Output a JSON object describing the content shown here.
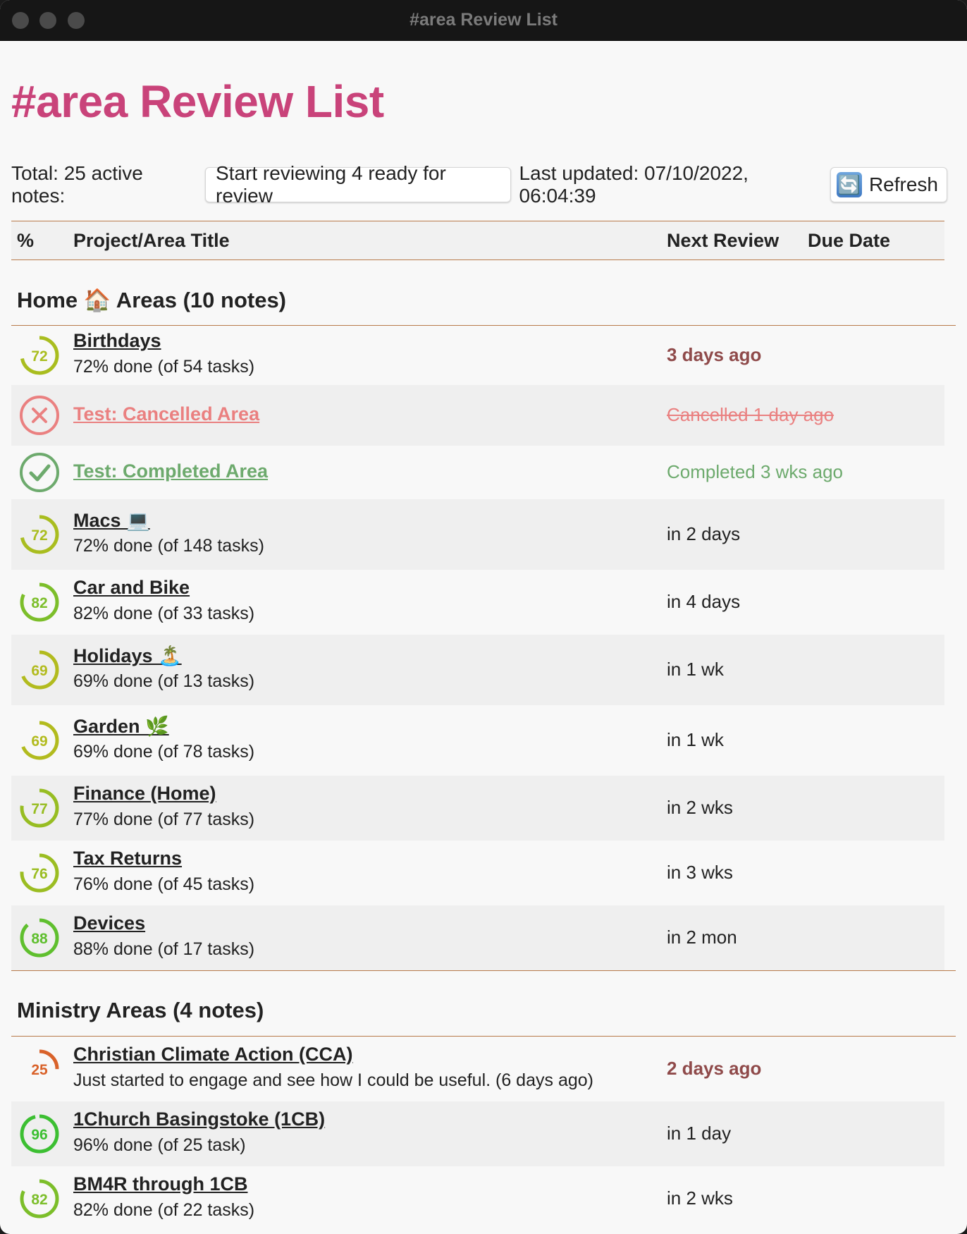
{
  "window": {
    "title": "#area Review List"
  },
  "page": {
    "heading": "#area Review List"
  },
  "toolbar": {
    "total_label": "Total: 25 active notes:",
    "start_button": "Start reviewing 4 ready for review",
    "last_updated": "Last updated: 07/10/2022, 06:04:39",
    "refresh_button": "Refresh",
    "refresh_icon": "🔄"
  },
  "table": {
    "headers": {
      "pct": "%",
      "title": "Project/Area Title",
      "next_review": "Next Review",
      "due_date": "Due Date"
    }
  },
  "sections": [
    {
      "title": "Home 🏠 Areas (10 notes)",
      "rows": [
        {
          "title": "Birthdays",
          "sub": "72% done (of 54 tasks)",
          "review": "3 days ago",
          "status": "overdue",
          "pct": 72,
          "color": "#a9bd1f"
        },
        {
          "title": "Test: Cancelled Area",
          "sub": "",
          "review": "Cancelled 1 day ago",
          "status": "cancelled",
          "pct": null,
          "color": "#ea8080"
        },
        {
          "title": "Test: Completed Area",
          "sub": "",
          "review": "Completed 3 wks ago",
          "status": "completed",
          "pct": null,
          "color": "#6daa6d"
        },
        {
          "title": "Macs 💻",
          "sub": "72% done (of 148 tasks)",
          "review": "in 2 days",
          "status": "normal",
          "pct": 72,
          "color": "#a9bd1f"
        },
        {
          "title": "Car and Bike",
          "sub": "82% done (of 33 tasks)",
          "review": "in 4 days",
          "status": "normal",
          "pct": 82,
          "color": "#7cbe2a"
        },
        {
          "title": "Holidays 🏝️",
          "sub": "69% done (of 13 tasks)",
          "review": "in 1 wk",
          "status": "normal",
          "pct": 69,
          "color": "#b2bb1e"
        },
        {
          "title": "Garden 🌿",
          "sub": "69% done (of 78 tasks)",
          "review": "in 1 wk",
          "status": "normal",
          "pct": 69,
          "color": "#b2bb1e"
        },
        {
          "title": "Finance (Home)",
          "sub": "77% done (of 77 tasks)",
          "review": "in 2 wks",
          "status": "normal",
          "pct": 77,
          "color": "#97bd22"
        },
        {
          "title": "Tax Returns",
          "sub": "76% done (of 45 tasks)",
          "review": "in 3 wks",
          "status": "normal",
          "pct": 76,
          "color": "#9bbd22"
        },
        {
          "title": "Devices",
          "sub": "88% done (of 17 tasks)",
          "review": "in 2 mon",
          "status": "normal",
          "pct": 88,
          "color": "#5fbf2e"
        }
      ]
    },
    {
      "title": "Ministry Areas (4 notes)",
      "rows": [
        {
          "title": "Christian Climate Action (CCA)",
          "sub": "Just started to engage and see how I could be useful. (6 days ago)",
          "review": "2 days ago",
          "status": "overdue",
          "pct": 25,
          "color": "#d9622a"
        },
        {
          "title": "1Church Basingstoke (1CB)",
          "sub": "96% done (of 25 task)",
          "review": "in 1 day",
          "status": "normal",
          "pct": 96,
          "color": "#3cbf32"
        },
        {
          "title": "BM4R through 1CB",
          "sub": "82% done (of 22 tasks)",
          "review": "in 2 wks",
          "status": "normal",
          "pct": 82,
          "color": "#7cbe2a"
        }
      ]
    }
  ]
}
